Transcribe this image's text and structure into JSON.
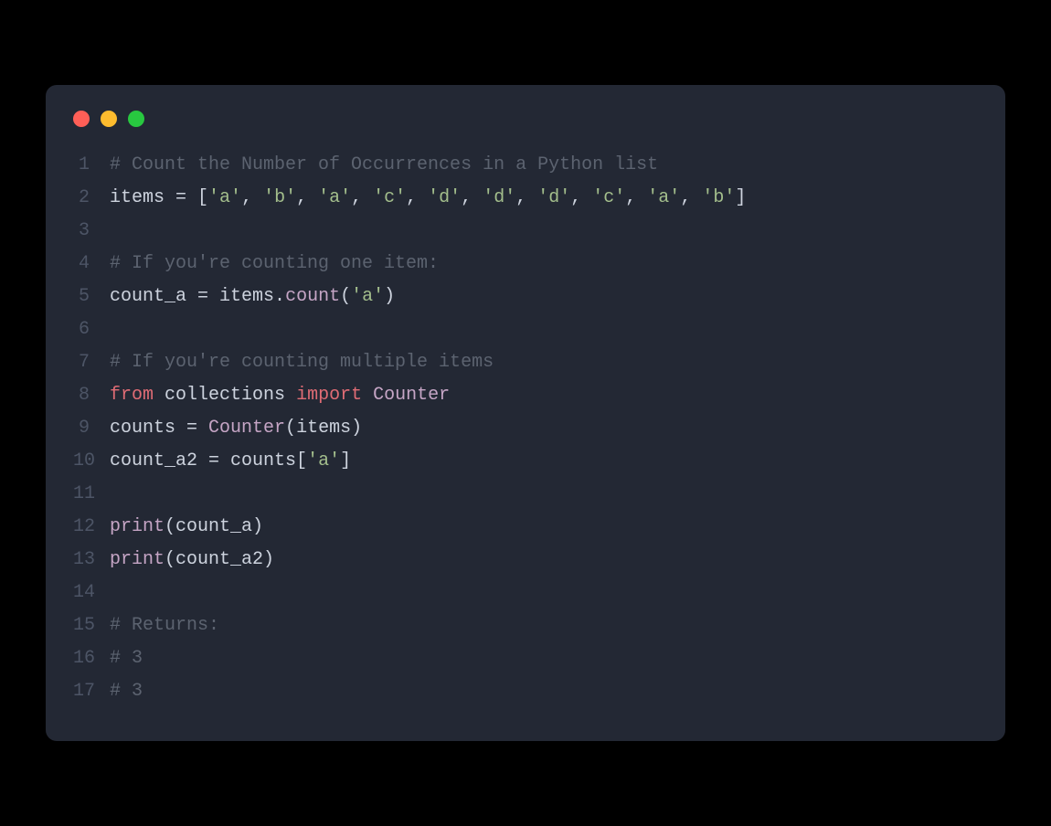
{
  "window": {
    "buttons": {
      "close": "red",
      "minimize": "yellow",
      "zoom": "green"
    }
  },
  "code": {
    "lines": {
      "l1": {
        "n": "1",
        "comment": "# Count the Number of Occurrences in a Python list"
      },
      "l2": {
        "n": "2",
        "v_items": "items",
        "op_eq": " = ",
        "lb": "[",
        "s0": "'a'",
        "s1": "'b'",
        "s2": "'a'",
        "s3": "'c'",
        "s4": "'d'",
        "s5": "'d'",
        "s6": "'d'",
        "s7": "'c'",
        "s8": "'a'",
        "s9": "'b'",
        "comma": ", ",
        "rb": "]"
      },
      "l3": {
        "n": "3"
      },
      "l4": {
        "n": "4",
        "comment": "# If you're counting one item:"
      },
      "l5": {
        "n": "5",
        "v_count_a": "count_a",
        "op_eq": " = ",
        "v_items": "items",
        "dot": ".",
        "fn_count": "count",
        "lp": "(",
        "s_a": "'a'",
        "rp": ")"
      },
      "l6": {
        "n": "6"
      },
      "l7": {
        "n": "7",
        "comment": "# If you're counting multiple items"
      },
      "l8": {
        "n": "8",
        "kw_from": "from",
        "sp": " ",
        "mod": "collections",
        "kw_import": "import",
        "cls": "Counter"
      },
      "l9": {
        "n": "9",
        "v_counts": "counts",
        "op_eq": " = ",
        "cls": "Counter",
        "lp": "(",
        "v_items": "items",
        "rp": ")"
      },
      "l10": {
        "n": "10",
        "v_count_a2": "count_a2",
        "op_eq": " = ",
        "v_counts": "counts",
        "lb": "[",
        "s_a": "'a'",
        "rb": "]"
      },
      "l11": {
        "n": "11"
      },
      "l12": {
        "n": "12",
        "fn_print": "print",
        "lp": "(",
        "arg": "count_a",
        "rp": ")"
      },
      "l13": {
        "n": "13",
        "fn_print": "print",
        "lp": "(",
        "arg": "count_a2",
        "rp": ")"
      },
      "l14": {
        "n": "14"
      },
      "l15": {
        "n": "15",
        "comment": "# Returns:"
      },
      "l16": {
        "n": "16",
        "comment": "# 3"
      },
      "l17": {
        "n": "17",
        "comment": "# 3"
      }
    }
  }
}
